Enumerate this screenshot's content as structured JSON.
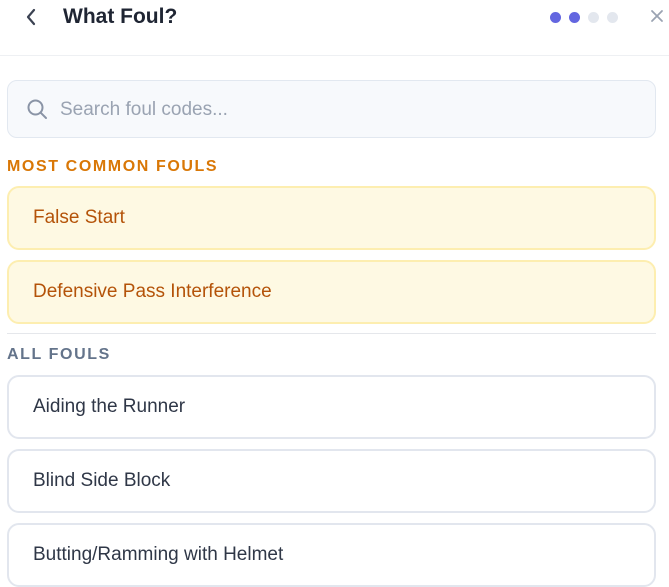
{
  "header": {
    "title": "What Foul?",
    "steps": {
      "total": 4,
      "current": 2
    }
  },
  "icons": {
    "back": "chevron-left-icon",
    "close": "close-icon",
    "search": "search-icon"
  },
  "search": {
    "placeholder": "Search foul codes...",
    "value": ""
  },
  "sections": {
    "common": {
      "heading": "MOST COMMON FOULS",
      "items": [
        "False Start",
        "Defensive Pass Interference"
      ]
    },
    "all": {
      "heading": "ALL FOULS",
      "items": [
        "Aiding the Runner",
        "Blind Side Block",
        "Butting/Ramming with Helmet"
      ]
    }
  },
  "colors": {
    "accent": "#6366e0",
    "common_heading": "#d97706",
    "common_text": "#b45309",
    "common_bg": "#fef9e3",
    "all_heading": "#64748b"
  }
}
